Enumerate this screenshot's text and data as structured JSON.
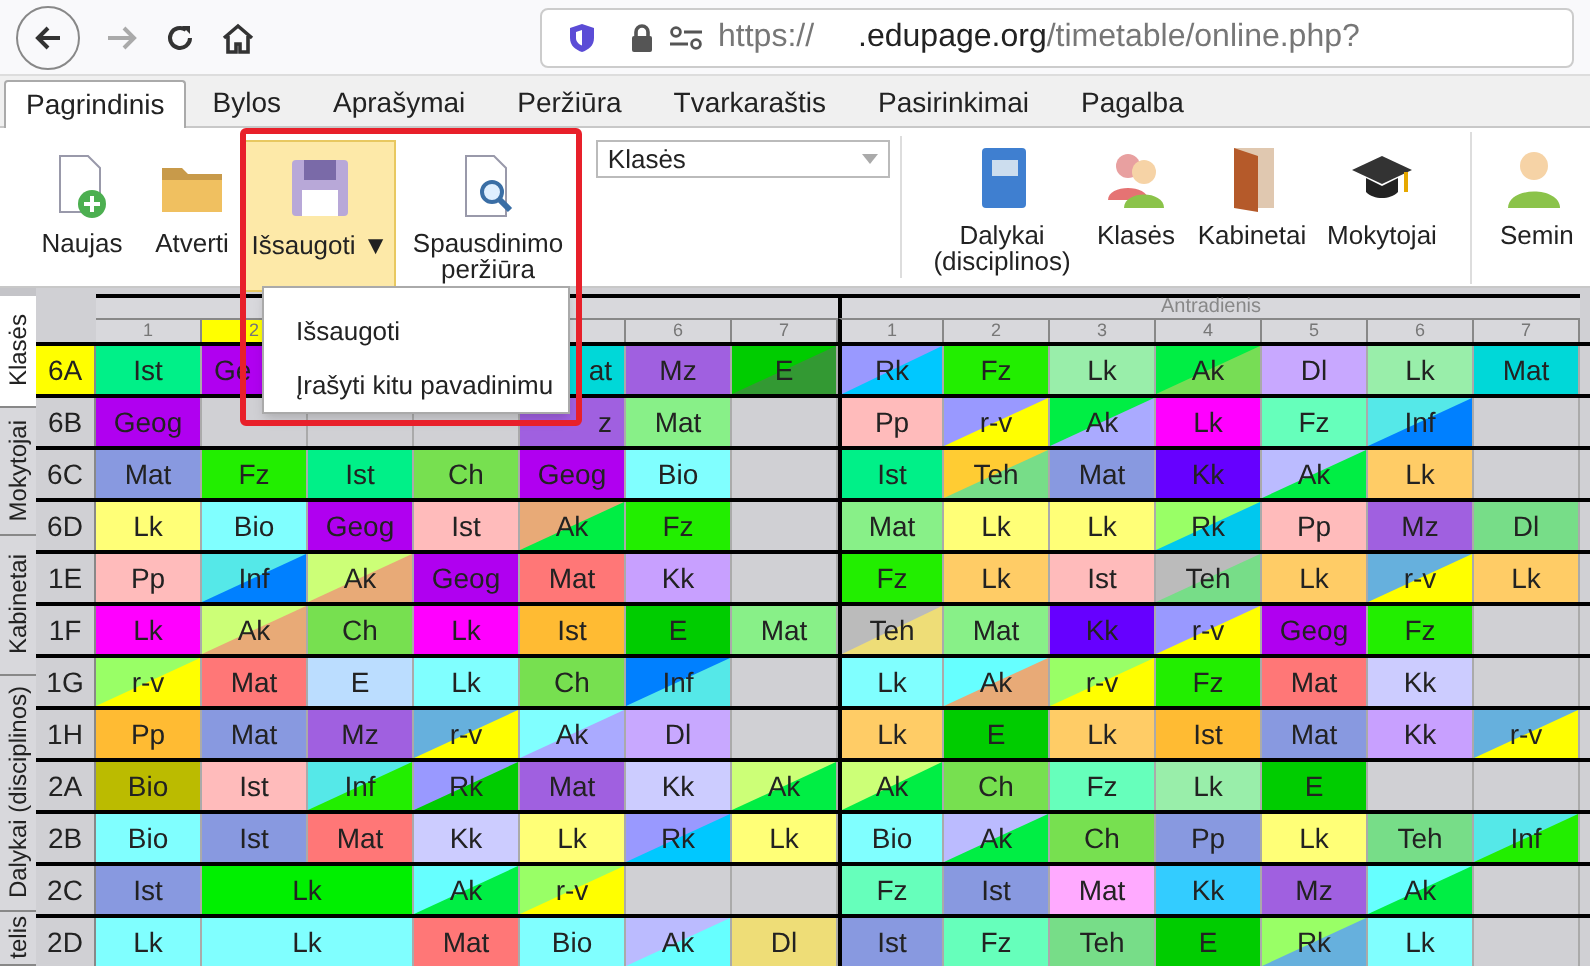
{
  "browser": {
    "url_scheme": "https://",
    "url_domain": ".edupage.org",
    "url_path": "/timetable/online.php?"
  },
  "menu_tabs": [
    {
      "label": "Pagrindinis",
      "selected": true
    },
    {
      "label": "Bylos",
      "selected": false
    },
    {
      "label": "Aprašymai",
      "selected": false
    },
    {
      "label": "Peržiūra",
      "selected": false
    },
    {
      "label": "Tvarkaraštis",
      "selected": false
    },
    {
      "label": "Pasirinkimai",
      "selected": false
    },
    {
      "label": "Pagalba",
      "selected": false
    }
  ],
  "ribbon": {
    "left": [
      {
        "kind": "new",
        "label": "Naujas"
      },
      {
        "kind": "open",
        "label": "Atverti"
      },
      {
        "kind": "save",
        "label": "Išsaugoti",
        "caret": "▼",
        "highlighted": true
      },
      {
        "kind": "preview",
        "label": "Spausdinimo peržiūra",
        "highlighted": false
      }
    ],
    "select": {
      "value": "Klasės"
    },
    "right": [
      {
        "kind": "book",
        "label": "Dalykai (disciplinos)"
      },
      {
        "kind": "people",
        "label": "Klasės"
      },
      {
        "kind": "door",
        "label": "Kabinetai"
      },
      {
        "kind": "cap",
        "label": "Mokytojai"
      },
      {
        "kind": "person",
        "label": "Semin"
      }
    ]
  },
  "save_menu": {
    "items": [
      "Išsaugoti",
      "Įrašyti kitu pavadinimu"
    ]
  },
  "side_tabs": [
    {
      "label": "Klasės",
      "selected": true
    },
    {
      "label": "Mokytojai",
      "selected": false
    },
    {
      "label": "Kabinetai",
      "selected": false
    },
    {
      "label": "Dalykai (disciplinos)",
      "selected": false
    },
    {
      "label": "telis",
      "selected": false
    }
  ],
  "timetable": {
    "days": [
      {
        "periods_before_menu": [
          {
            "label": "1",
            "highlighted": false
          },
          {
            "label": "2",
            "highlighted": true
          }
        ],
        "periods_after_menu": [
          {
            "highlighted": false
          },
          {
            "label": "6",
            "highlighted": false
          },
          {
            "label": "7",
            "highlighted": false
          }
        ]
      },
      {
        "label": "Antradienis",
        "periods": [
          {
            "label": "1",
            "highlighted": false
          },
          {
            "label": "2",
            "highlighted": false
          },
          {
            "label": "3",
            "highlighted": false
          },
          {
            "label": "4",
            "highlighted": false
          },
          {
            "label": "5",
            "highlighted": false
          },
          {
            "label": "6",
            "highlighted": false
          },
          {
            "label": "7",
            "highlighted": false
          }
        ]
      }
    ],
    "rows": [
      {
        "class": "6A",
        "selected": true,
        "cells": [
          {
            "text": "Ist",
            "color": "#00f088"
          },
          {
            "text": "Ge",
            "color": "#b000f0",
            "kind": "cut-right"
          },
          null,
          null,
          {
            "text": "at",
            "color": "#00d8d8",
            "kind": "cut-left"
          },
          {
            "text": "Mz",
            "color": "#a060e0"
          },
          {
            "text": "E",
            "color": "#00cc00",
            "split": {
              "color": "#339933"
            }
          },
          {
            "text": "Rk",
            "color": "#9999ff",
            "split": {
              "color": "#00c8ff"
            }
          },
          {
            "text": "Fz",
            "color": "#22ee00"
          },
          {
            "text": "Lk",
            "color": "#99eeaa"
          },
          {
            "text": "Ak",
            "color": "#00ee44",
            "split": {
              "color": "#77dd55"
            }
          },
          {
            "text": "Dl",
            "color": "#c8a8ff"
          },
          {
            "text": "Lk",
            "color": "#99eeaa"
          },
          {
            "text": "Mat",
            "color": "#00d8d8"
          }
        ]
      },
      {
        "class": "6B",
        "selected": false,
        "cells": [
          {
            "text": "Geog",
            "color": "#b000f0"
          },
          null,
          null,
          null,
          {
            "text": "z",
            "color": "#a060e0",
            "kind": "cut-left"
          },
          {
            "text": "Mat",
            "color": "#88f088"
          },
          null,
          {
            "text": "Pp",
            "color": "#ffbbbb"
          },
          {
            "text": "r-v",
            "color": "#9999ff",
            "split": {
              "color": "#ffff00"
            }
          },
          {
            "text": "Ak",
            "color": "#00ee44",
            "split": {
              "color": "#aaaaff"
            }
          },
          {
            "text": "Lk",
            "color": "#ff00ff"
          },
          {
            "text": "Fz",
            "color": "#66ffbb"
          },
          {
            "text": "Inf",
            "color": "#55e8e8",
            "split": {
              "color": "#0080ff"
            }
          },
          null
        ]
      },
      {
        "class": "6C",
        "selected": false,
        "cells": [
          {
            "text": "Mat",
            "color": "#8899e0"
          },
          {
            "text": "Fz",
            "color": "#22ee00"
          },
          {
            "text": "Ist",
            "color": "#00f088"
          },
          {
            "text": "Ch",
            "color": "#77e050"
          },
          {
            "text": "Geog",
            "color": "#b000f0"
          },
          {
            "text": "Bio",
            "color": "#80ffff"
          },
          null,
          {
            "text": "Ist",
            "color": "#00f088"
          },
          {
            "text": "Teh",
            "color": "#ffcc33",
            "split": {
              "color": "#77dd88"
            }
          },
          {
            "text": "Mat",
            "color": "#8899e0"
          },
          {
            "text": "Kk",
            "color": "#6600ff"
          },
          {
            "text": "Ak",
            "color": "#bbbbff",
            "split": {
              "color": "#00ee44"
            }
          },
          {
            "text": "Lk",
            "color": "#ffcc66"
          },
          null
        ]
      },
      {
        "class": "6D",
        "selected": false,
        "cells": [
          {
            "text": "Lk",
            "color": "#ffff77"
          },
          {
            "text": "Bio",
            "color": "#80ffff"
          },
          {
            "text": "Geog",
            "color": "#b000f0"
          },
          {
            "text": "Ist",
            "color": "#ffbbbb"
          },
          {
            "text": "Ak",
            "color": "#e8aa77",
            "split": {
              "color": "#00ee44"
            }
          },
          {
            "text": "Fz",
            "color": "#22ee00"
          },
          null,
          {
            "text": "Mat",
            "color": "#88f088"
          },
          {
            "text": "Lk",
            "color": "#ffff77"
          },
          {
            "text": "Lk",
            "color": "#ffff77"
          },
          {
            "text": "Rk",
            "color": "#99ff66",
            "split": {
              "color": "#00c8ee"
            }
          },
          {
            "text": "Pp",
            "color": "#ffbbbb"
          },
          {
            "text": "Mz",
            "color": "#a060e0"
          },
          {
            "text": "Dl",
            "color": "#77dd88"
          }
        ]
      },
      {
        "class": "1E",
        "selected": false,
        "cells": [
          {
            "text": "Pp",
            "color": "#ffbbbb"
          },
          {
            "text": "Inf",
            "color": "#55e8e8",
            "split": {
              "color": "#0080ff"
            }
          },
          {
            "text": "Ak",
            "color": "#ccff77",
            "split": {
              "color": "#e8aa77"
            }
          },
          {
            "text": "Geog",
            "color": "#b000f0"
          },
          {
            "text": "Mat",
            "color": "#ff7777"
          },
          {
            "text": "Kk",
            "color": "#c8a0ff"
          },
          null,
          {
            "text": "Fz",
            "color": "#22ee00"
          },
          {
            "text": "Lk",
            "color": "#ffcc66"
          },
          {
            "text": "Ist",
            "color": "#ffbbbb"
          },
          {
            "text": "Teh",
            "color": "#bbbbbb",
            "split": {
              "color": "#77dd88"
            }
          },
          {
            "text": "Lk",
            "color": "#ffcc66"
          },
          {
            "text": "r-v",
            "color": "#66b0dd",
            "split": {
              "color": "#ffff00"
            }
          },
          {
            "text": "Lk",
            "color": "#ffcc66"
          }
        ]
      },
      {
        "class": "1F",
        "selected": false,
        "cells": [
          {
            "text": "Lk",
            "color": "#ff00ff"
          },
          {
            "text": "Ak",
            "color": "#ccff77",
            "split": {
              "color": "#e8aa77"
            }
          },
          {
            "text": "Ch",
            "color": "#77e050"
          },
          {
            "text": "Lk",
            "color": "#ff00ff"
          },
          {
            "text": "Ist",
            "color": "#ffbb33"
          },
          {
            "text": "E",
            "color": "#00cc00"
          },
          {
            "text": "Mat",
            "color": "#88f088"
          },
          {
            "text": "Teh",
            "color": "#bbbbbb",
            "split": {
              "color": "#eedd77"
            }
          },
          {
            "text": "Mat",
            "color": "#88f088"
          },
          {
            "text": "Kk",
            "color": "#6600ff"
          },
          {
            "text": "r-v",
            "color": "#9999ff",
            "split": {
              "color": "#ffff00"
            }
          },
          {
            "text": "Geog",
            "color": "#b000f0"
          },
          {
            "text": "Fz",
            "color": "#22ee00"
          },
          null
        ]
      },
      {
        "class": "1G",
        "selected": false,
        "cells": [
          {
            "text": "r-v",
            "color": "#99ff66",
            "split": {
              "color": "#ffff00"
            }
          },
          {
            "text": "Mat",
            "color": "#ff7777"
          },
          {
            "text": "E",
            "color": "#bbddff"
          },
          {
            "text": "Lk",
            "color": "#80ffff"
          },
          {
            "text": "Ch",
            "color": "#77e050"
          },
          {
            "text": "Inf",
            "color": "#0080ff",
            "split": {
              "color": "#55e8e8"
            }
          },
          null,
          {
            "text": "Lk",
            "color": "#80ffff"
          },
          {
            "text": "Ak",
            "color": "#66ffff",
            "split": {
              "color": "#e8aa77"
            }
          },
          {
            "text": "r-v",
            "color": "#99ff66",
            "split": {
              "color": "#ffff00"
            }
          },
          {
            "text": "Fz",
            "color": "#22ee00"
          },
          {
            "text": "Mat",
            "color": "#ff7777"
          },
          {
            "text": "Kk",
            "color": "#ccccff"
          },
          null
        ]
      },
      {
        "class": "1H",
        "selected": false,
        "cells": [
          {
            "text": "Pp",
            "color": "#ffbb33"
          },
          {
            "text": "Mat",
            "color": "#8899e0"
          },
          {
            "text": "Mz",
            "color": "#a060e0"
          },
          {
            "text": "r-v",
            "color": "#66b0dd",
            "split": {
              "color": "#ffff00"
            }
          },
          {
            "text": "Ak",
            "color": "#80ffff",
            "split": {
              "color": "#aaaaff"
            }
          },
          {
            "text": "Dl",
            "color": "#c8a8ff"
          },
          null,
          {
            "text": "Lk",
            "color": "#ffcc66"
          },
          {
            "text": "E",
            "color": "#00cc00"
          },
          {
            "text": "Lk",
            "color": "#ffcc66"
          },
          {
            "text": "Ist",
            "color": "#ffbb33"
          },
          {
            "text": "Mat",
            "color": "#8899e0"
          },
          {
            "text": "Kk",
            "color": "#c8a0ff"
          },
          {
            "text": "r-v",
            "color": "#66b0dd",
            "split": {
              "color": "#ffff00"
            }
          }
        ]
      },
      {
        "class": "2A",
        "selected": false,
        "cells": [
          {
            "text": "Bio",
            "color": "#bbbb00"
          },
          {
            "text": "Ist",
            "color": "#ffbbbb"
          },
          {
            "text": "Inf",
            "color": "#55e8e8",
            "split": {
              "color": "#22ee00"
            }
          },
          {
            "text": "Rk",
            "color": "#9999ff",
            "split": {
              "color": "#00cc00"
            }
          },
          {
            "text": "Mat",
            "color": "#a060e0"
          },
          {
            "text": "Kk",
            "color": "#ccccff"
          },
          {
            "text": "Ak",
            "color": "#ccff77",
            "split": {
              "color": "#00ee44"
            }
          },
          {
            "text": "Ak",
            "color": "#ccff77",
            "split": {
              "color": "#00ee44"
            }
          },
          {
            "text": "Ch",
            "color": "#77e050"
          },
          {
            "text": "Fz",
            "color": "#66ffbb"
          },
          {
            "text": "Lk",
            "color": "#99eeaa"
          },
          {
            "text": "E",
            "color": "#00cc00"
          },
          null,
          null
        ]
      },
      {
        "class": "2B",
        "selected": false,
        "cells": [
          {
            "text": "Bio",
            "color": "#80ffff"
          },
          {
            "text": "Ist",
            "color": "#8899e0"
          },
          {
            "text": "Mat",
            "color": "#ff7777"
          },
          {
            "text": "Kk",
            "color": "#ccccff"
          },
          {
            "text": "Lk",
            "color": "#ffff77"
          },
          {
            "text": "Rk",
            "color": "#9999ff",
            "split": {
              "color": "#00c8ff"
            }
          },
          {
            "text": "Lk",
            "color": "#ffff77"
          },
          {
            "text": "Bio",
            "color": "#80ffff"
          },
          {
            "text": "Ak",
            "color": "#bbbbff",
            "split": {
              "color": "#00ee44"
            }
          },
          {
            "text": "Ch",
            "color": "#77e050"
          },
          {
            "text": "Pp",
            "color": "#8899e0"
          },
          {
            "text": "Lk",
            "color": "#ffff77"
          },
          {
            "text": "Teh",
            "color": "#77dd88"
          },
          {
            "text": "Inf",
            "color": "#55e8e8",
            "split": {
              "color": "#22ee00"
            }
          }
        ]
      },
      {
        "class": "2C",
        "selected": false,
        "cells": [
          {
            "text": "Ist",
            "color": "#8899e0"
          },
          {
            "text": "Lk",
            "color": "#00f000",
            "double": true
          },
          null,
          {
            "text": "Ak",
            "color": "#66ffff",
            "split": {
              "color": "#00ee44"
            }
          },
          {
            "text": "r-v",
            "color": "#99ff66",
            "split": {
              "color": "#ffff00"
            }
          },
          null,
          null,
          {
            "text": "Fz",
            "color": "#66ffbb"
          },
          {
            "text": "Ist",
            "color": "#8899e0"
          },
          {
            "text": "Mat",
            "color": "#ffaaff"
          },
          {
            "text": "Kk",
            "color": "#33ccff"
          },
          {
            "text": "Mz",
            "color": "#a060e0"
          },
          {
            "text": "Ak",
            "color": "#66ffff",
            "split": {
              "color": "#00ee44"
            }
          },
          null
        ]
      },
      {
        "class": "2D",
        "selected": false,
        "cells": [
          {
            "text": "Lk",
            "color": "#80ffff"
          },
          {
            "text": "Lk",
            "color": "#80ffff",
            "double": true
          },
          null,
          {
            "text": "Mat",
            "color": "#ff7777"
          },
          {
            "text": "Bio",
            "color": "#80ffff"
          },
          {
            "text": "Ak",
            "color": "#bbbbff",
            "split": {
              "color": "#66ffff"
            }
          },
          {
            "text": "Dl",
            "color": "#eedd77"
          },
          {
            "text": "Ist",
            "color": "#8899e0"
          },
          {
            "text": "Fz",
            "color": "#66ffbb"
          },
          {
            "text": "Teh",
            "color": "#77dd88"
          },
          {
            "text": "E",
            "color": "#00cc00"
          },
          {
            "text": "Rk",
            "color": "#99ff66",
            "split": {
              "color": "#66b0dd"
            }
          },
          {
            "text": "Lk",
            "color": "#80ffff"
          },
          null
        ]
      }
    ]
  }
}
